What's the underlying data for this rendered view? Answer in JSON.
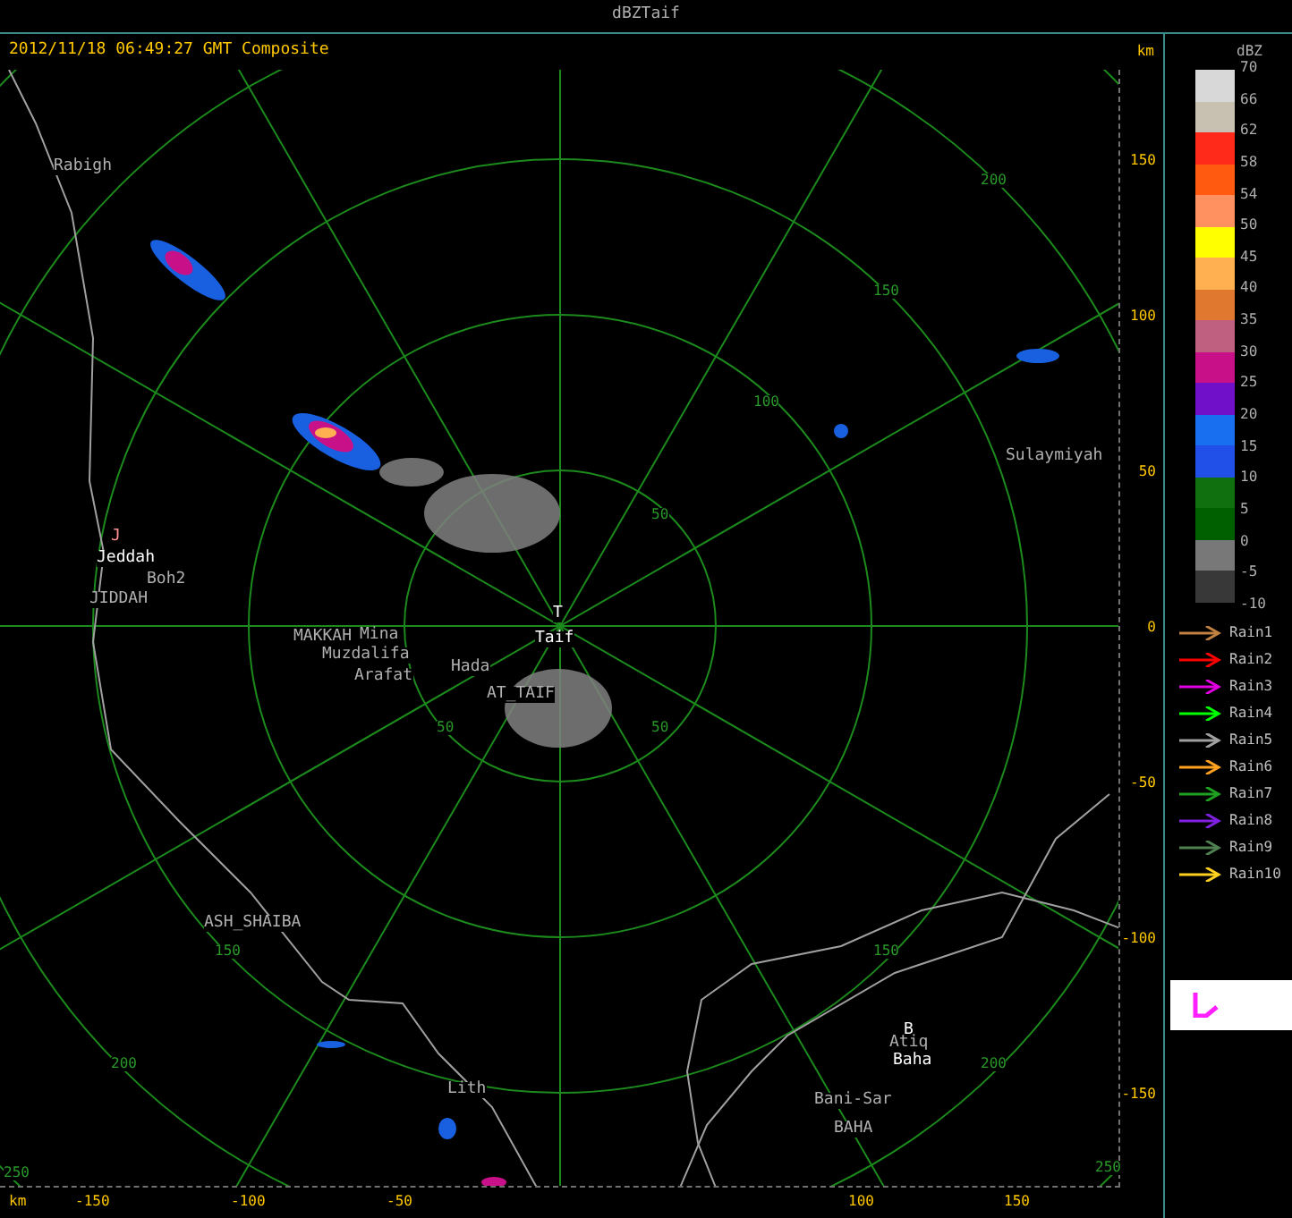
{
  "window": {
    "title": "dBZTaif"
  },
  "header": {
    "timestamp": "2012/11/18 06:49:27 GMT Composite",
    "unit": "km"
  },
  "map": {
    "places": [
      {
        "name": "Rabigh",
        "kind": "minor"
      },
      {
        "name": "J",
        "kind": "marker"
      },
      {
        "name": "Jeddah",
        "kind": "major"
      },
      {
        "name": "Boh2",
        "kind": "minor"
      },
      {
        "name": "JIDDAH",
        "kind": "minor"
      },
      {
        "name": "MAKKAH",
        "kind": "minor"
      },
      {
        "name": "Mina",
        "kind": "minor"
      },
      {
        "name": "Muzdalifa",
        "kind": "minor"
      },
      {
        "name": "Arafat",
        "kind": "minor"
      },
      {
        "name": "Hada",
        "kind": "minor"
      },
      {
        "name": "T",
        "kind": "major"
      },
      {
        "name": "Taif",
        "kind": "major"
      },
      {
        "name": "AT_TAIF",
        "kind": "minor"
      },
      {
        "name": "Sulaymiyah",
        "kind": "minor"
      },
      {
        "name": "ASH_SHAIBA",
        "kind": "minor"
      },
      {
        "name": "Lith",
        "kind": "minor"
      },
      {
        "name": "B",
        "kind": "major"
      },
      {
        "name": "Atiq",
        "kind": "minor"
      },
      {
        "name": "Baha",
        "kind": "major"
      },
      {
        "name": "Bani-Sar",
        "kind": "minor"
      },
      {
        "name": "BAHA",
        "kind": "minor"
      }
    ],
    "ring_labels": [
      "200",
      "150",
      "100",
      "50",
      "50",
      "50",
      "150",
      "150",
      "200",
      "200",
      "250",
      "250"
    ],
    "right_axis": {
      "ticks": [
        "150",
        "100",
        "50",
        "0",
        "-50",
        "-100",
        "-150"
      ]
    },
    "bottom_axis": {
      "unit": "km",
      "ticks": [
        "-150",
        "-100",
        "-50",
        "100",
        "150"
      ]
    }
  },
  "legend": {
    "title": "dBZ",
    "bins": [
      {
        "color": "#d8d8d8"
      },
      {
        "color": "#c8c0b0"
      },
      {
        "color": "#ff2a1a"
      },
      {
        "color": "#ff5a10"
      },
      {
        "color": "#ff9060"
      },
      {
        "color": "#ffff00"
      },
      {
        "color": "#ffb050"
      },
      {
        "color": "#e07830"
      },
      {
        "color": "#c06080"
      },
      {
        "color": "#c81088"
      },
      {
        "color": "#7010c8"
      },
      {
        "color": "#1870f0"
      },
      {
        "color": "#2050e8"
      },
      {
        "color": "#107010"
      },
      {
        "color": "#006000"
      },
      {
        "color": "#787878"
      },
      {
        "color": "#383838"
      }
    ],
    "labels": [
      "70",
      "66",
      "62",
      "58",
      "54",
      "50",
      "45",
      "40",
      "35",
      "30",
      "25",
      "20",
      "15",
      "10",
      "5",
      "0",
      "-5",
      "-10"
    ],
    "tracks": [
      {
        "label": "Rain1",
        "color": "#c08040"
      },
      {
        "label": "Rain2",
        "color": "#ff0000"
      },
      {
        "label": "Rain3",
        "color": "#e000e0"
      },
      {
        "label": "Rain4",
        "color": "#00ff00"
      },
      {
        "label": "Rain5",
        "color": "#a0a0a0"
      },
      {
        "label": "Rain6",
        "color": "#ffa020"
      },
      {
        "label": "Rain7",
        "color": "#20a020"
      },
      {
        "label": "Rain8",
        "color": "#8020e0"
      },
      {
        "label": "Rain9",
        "color": "#508050"
      },
      {
        "label": "Rain10",
        "color": "#ffd020"
      }
    ]
  }
}
